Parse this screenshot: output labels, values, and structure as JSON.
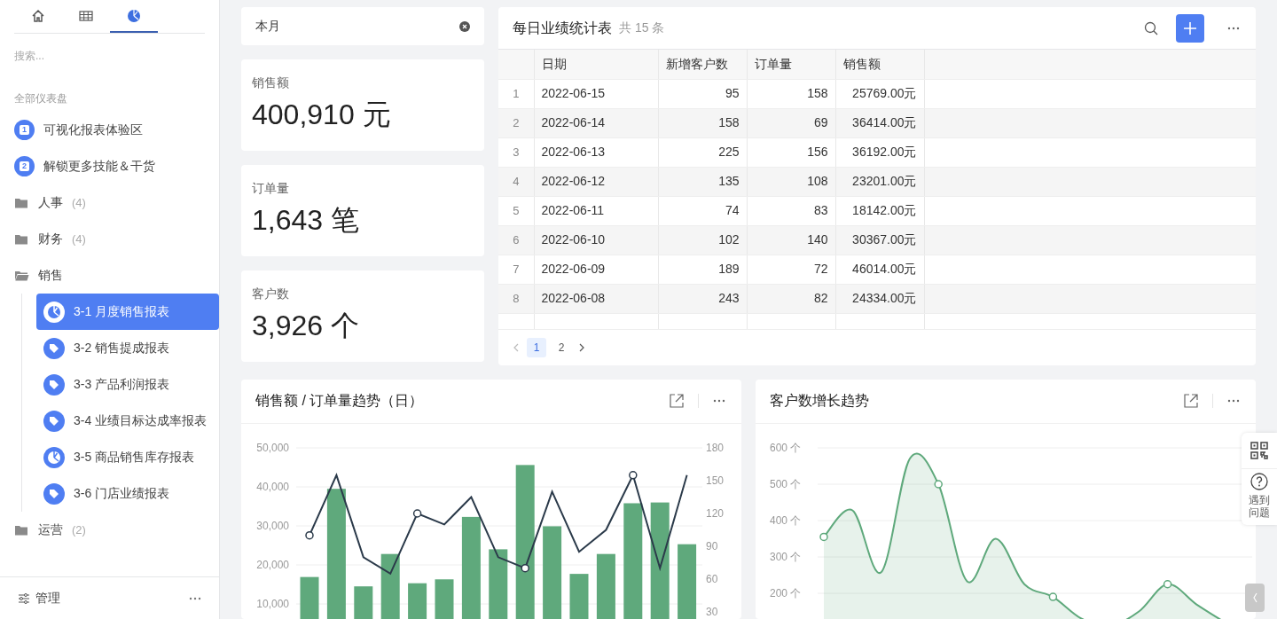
{
  "sidebar": {
    "tabs": [
      {
        "kind": "home",
        "selected": false
      },
      {
        "kind": "grid",
        "selected": false
      },
      {
        "kind": "chart",
        "selected": true
      }
    ],
    "search": {
      "placeholder": "搜索..."
    },
    "section_label": "全部仪表盘",
    "items": [
      {
        "kind": "numbered",
        "badge": "1",
        "label": "可视化报表体验区"
      },
      {
        "kind": "numbered",
        "badge": "2",
        "label": "解锁更多技能＆干货"
      },
      {
        "kind": "folder",
        "label": "人事",
        "count": "(4)",
        "expanded": false
      },
      {
        "kind": "folder",
        "label": "财务",
        "count": "(4)",
        "expanded": false
      },
      {
        "kind": "folder",
        "label": "销售",
        "expanded": true,
        "children": [
          {
            "kind": "chart",
            "label": "3-1 月度销售报表",
            "selected": true
          },
          {
            "kind": "tag",
            "label": "3-2 销售提成报表",
            "selected": false
          },
          {
            "kind": "tag",
            "label": "3-3 产品利润报表",
            "selected": false
          },
          {
            "kind": "tag",
            "label": "3-4 业绩目标达成率报表",
            "selected": false
          },
          {
            "kind": "chart",
            "label": "3-5 商品销售库存报表",
            "selected": false
          },
          {
            "kind": "tag",
            "label": "3-6 门店业绩报表",
            "selected": false
          }
        ]
      },
      {
        "kind": "folder",
        "label": "运营",
        "count": "(2)",
        "expanded": false
      }
    ],
    "footer": {
      "label": "管理"
    }
  },
  "filter": {
    "value": "本月"
  },
  "stats": [
    {
      "label": "销售额",
      "value": "400,910 元"
    },
    {
      "label": "订单量",
      "value": "1,643 笔"
    },
    {
      "label": "客户数",
      "value": "3,926 个"
    }
  ],
  "table": {
    "title": "每日业绩统计表",
    "count": "共 15 条",
    "columns": [
      "",
      "日期",
      "新增客户数",
      "订单量",
      "销售额"
    ],
    "rows": [
      [
        "1",
        "2022-06-15",
        "95",
        "158",
        "25769.00元"
      ],
      [
        "2",
        "2022-06-14",
        "158",
        "69",
        "36414.00元"
      ],
      [
        "3",
        "2022-06-13",
        "225",
        "156",
        "36192.00元"
      ],
      [
        "4",
        "2022-06-12",
        "135",
        "108",
        "23201.00元"
      ],
      [
        "5",
        "2022-06-11",
        "74",
        "83",
        "18142.00元"
      ],
      [
        "6",
        "2022-06-10",
        "102",
        "140",
        "30367.00元"
      ],
      [
        "7",
        "2022-06-09",
        "189",
        "72",
        "46014.00元"
      ],
      [
        "8",
        "2022-06-08",
        "243",
        "82",
        "24334.00元"
      ]
    ],
    "pages": [
      {
        "label": "1",
        "selected": true
      },
      {
        "label": "2",
        "selected": false
      }
    ]
  },
  "charts": [
    {
      "title": "销售额 / 订单量趋势（日）",
      "chart_data": {
        "type": "bar",
        "grid": true,
        "ylim": [
          0,
          50000
        ],
        "y2lim": [
          0,
          180
        ],
        "yticks": [
          {
            "value": 10000,
            "label": "10,000"
          },
          {
            "value": 20000,
            "label": "20,000"
          },
          {
            "value": 30000,
            "label": "30,000"
          },
          {
            "value": 40000,
            "label": "40,000"
          },
          {
            "value": 50000,
            "label": "50,000"
          }
        ],
        "y2ticks": [
          30,
          60,
          90,
          120,
          150,
          180
        ],
        "series": [
          {
            "color": "#5fa97c",
            "values": [
              16900,
              39500,
              14500,
              22800,
              15300,
              16300,
              32300,
              24000,
              45600,
              29900,
              17700,
              22800,
              35800,
              36000,
              25300
            ]
          },
          {
            "type": "line",
            "axis": "y2",
            "color": "#2b3a4a",
            "values": [
              100,
              155,
              80,
              65,
              120,
              110,
              135,
              80,
              70,
              140,
              85,
              105,
              155,
              70,
              155
            ]
          }
        ]
      }
    },
    {
      "title": "客户数增长趋势",
      "chart_data": {
        "type": "area",
        "grid": true,
        "ylim": [
          0,
          600
        ],
        "yticks": [
          {
            "value": 200,
            "label": "200 个"
          },
          {
            "value": 300,
            "label": "300 个"
          },
          {
            "value": 400,
            "label": "400 个"
          },
          {
            "value": 500,
            "label": "500 个"
          },
          {
            "value": 600,
            "label": "600 个"
          }
        ],
        "series": [
          {
            "color": "#5fa97c",
            "values": [
              355,
              428,
              258,
              570,
              500,
              233,
              350,
              225,
              190,
              130,
              110,
              150,
              225,
              170,
              120
            ]
          }
        ]
      }
    }
  ],
  "help": {
    "label": "遇到问题"
  }
}
